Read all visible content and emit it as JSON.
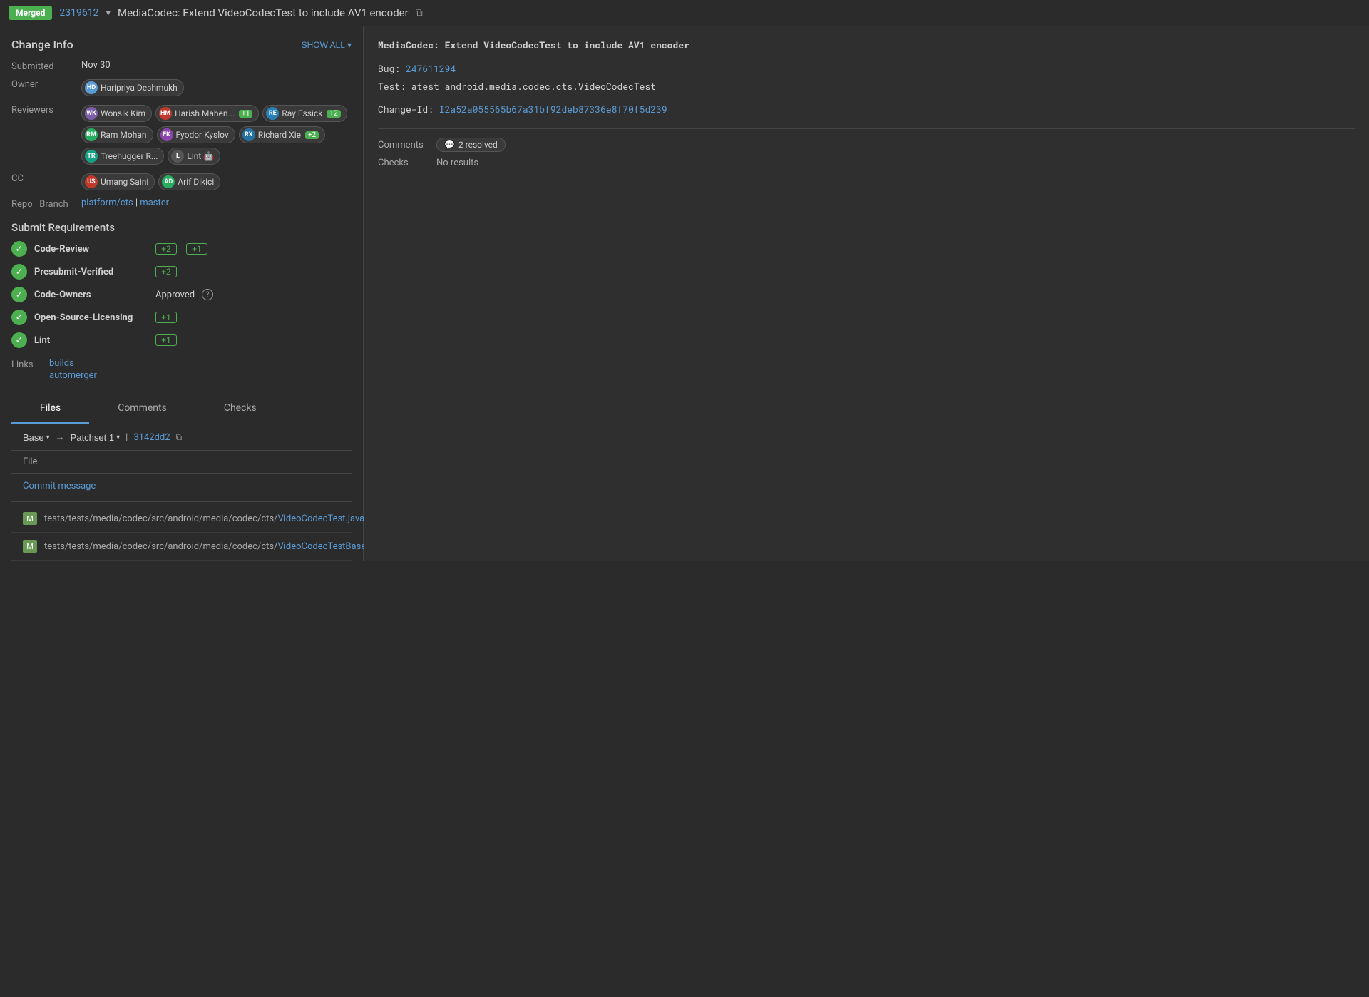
{
  "topbar": {
    "merged_label": "Merged",
    "change_number": "2319612",
    "title": "MediaCodec: Extend VideoCodecTest to include AV1 encoder",
    "copy_icon": "⧉"
  },
  "change_info": {
    "heading": "Change Info",
    "show_all_label": "SHOW ALL",
    "submitted_label": "Submitted",
    "submitted_date": "Nov 30",
    "owner_label": "Owner",
    "owner": "Haripriya Deshmukh",
    "reviewers_label": "Reviewers",
    "cc_label": "CC",
    "repo_branch_label": "Repo | Branch",
    "repo_link": "platform/cts",
    "branch_link": "master",
    "pipe_sep": "|",
    "reviewers": [
      {
        "name": "Wonsik Kim",
        "initials": "WK",
        "color": "#7b5ea7"
      },
      {
        "name": "Harish Mahen...",
        "initials": "HM",
        "color": "#c0392b",
        "plus": "+1"
      },
      {
        "name": "Ray Essick",
        "initials": "RE",
        "color": "#2980b9",
        "plus": "+2"
      },
      {
        "name": "Ram Mohan",
        "initials": "RM",
        "color": "#27ae60"
      },
      {
        "name": "Fyodor Kyslov",
        "initials": "FK",
        "color": "#8e44ad"
      },
      {
        "name": "Richard Xie",
        "initials": "RX",
        "color": "#2471a3",
        "plus": "+2"
      },
      {
        "name": "Treehugger R...",
        "initials": "TR",
        "color": "#16a085"
      },
      {
        "name": "Lint",
        "initials": "L",
        "color": "#555",
        "emoji": "🤖"
      }
    ],
    "cc": [
      {
        "name": "Umang Saini",
        "initials": "US",
        "color": "#c0392b"
      },
      {
        "name": "Arif Dikici",
        "initials": "AD",
        "color": "#27ae60"
      }
    ]
  },
  "submit_requirements": {
    "heading": "Submit Requirements",
    "requirements": [
      {
        "id": "code-review",
        "name": "Code-Review",
        "scores": [
          "+2",
          "+1"
        ]
      },
      {
        "id": "presubmit",
        "name": "Presubmit-Verified",
        "scores": [
          "+2"
        ]
      },
      {
        "id": "code-owners",
        "name": "Code-Owners",
        "approved_text": "Approved",
        "has_help": true
      },
      {
        "id": "oss-licensing",
        "name": "Open-Source-Licensing",
        "scores": [
          "+1"
        ]
      },
      {
        "id": "lint",
        "name": "Lint",
        "scores": [
          "+1"
        ]
      }
    ]
  },
  "links": {
    "label": "Links",
    "items": [
      {
        "id": "builds",
        "label": "builds",
        "url": "#"
      },
      {
        "id": "automerger",
        "label": "automerger",
        "url": "#"
      }
    ]
  },
  "tabs": [
    {
      "id": "files",
      "label": "Files",
      "active": true
    },
    {
      "id": "comments",
      "label": "Comments",
      "active": false
    },
    {
      "id": "checks",
      "label": "Checks",
      "active": false
    }
  ],
  "patchset": {
    "base_label": "Base",
    "arrow": "→",
    "patchset_label": "Patchset 1",
    "pipe": "|",
    "hash": "3142dd2",
    "copy_icon": "⧉"
  },
  "files_table": {
    "col_header": "File",
    "commit_message": "Commit message",
    "files": [
      {
        "marker": "M",
        "path_prefix": "tests/tests/media/codec/src/android/media/codec/cts/",
        "path_link": "VideoCodecTest.java",
        "full": "tests/tests/media/codec/src/android/media/codec/cts/VideoCodecTest.java"
      },
      {
        "marker": "M",
        "path_prefix": "tests/tests/media/codec/src/android/media/codec/cts/",
        "path_link": "VideoCodecTestBase.java",
        "full": "tests/tests/media/codec/src/android/media/codec/cts/VideoCodecTestBase.java"
      }
    ]
  },
  "commit_block": {
    "title": "MediaCodec: Extend VideoCodecTest to include AV1 encoder",
    "bug_prefix": "Bug: ",
    "bug_number": "247611294",
    "bug_link": "#",
    "test_line": "Test: atest android.media.codec.cts.VideoCodecTest",
    "change_id_prefix": "Change-Id: ",
    "change_id_value": "I2a52a055565b67a31bf92deb87336e8f70f5d239",
    "change_id_link": "#"
  },
  "meta": {
    "comments_label": "Comments",
    "resolved_icon": "💬",
    "resolved_label": "2 resolved",
    "checks_label": "Checks",
    "checks_value": "No results"
  }
}
